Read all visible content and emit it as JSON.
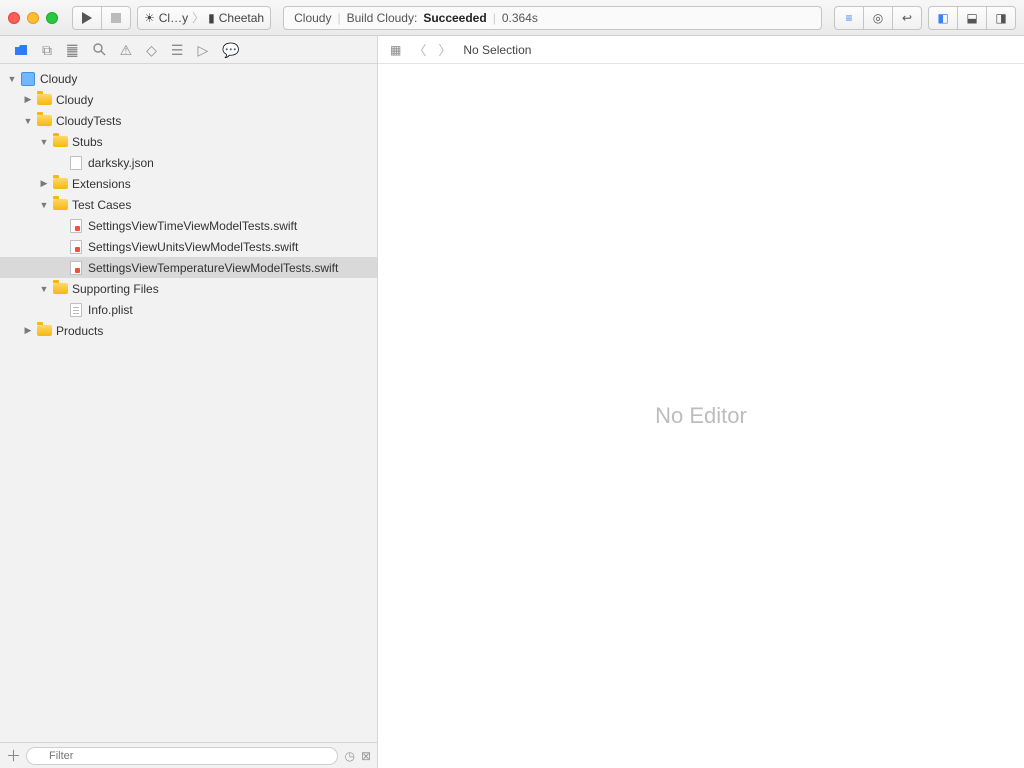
{
  "toolbar": {
    "scheme_app": "Cl…y",
    "scheme_device": "Cheetah",
    "activity_project": "Cloudy",
    "activity_prefix": "Build Cloudy:",
    "activity_status": "Succeeded",
    "activity_time": "0.364s"
  },
  "jumpbar": {
    "no_selection": "No Selection"
  },
  "editor": {
    "placeholder": "No Editor"
  },
  "filter": {
    "placeholder": "Filter"
  },
  "tree": [
    {
      "level": 0,
      "kind": "project",
      "expanded": true,
      "label": "Cloudy"
    },
    {
      "level": 1,
      "kind": "folder",
      "expanded": false,
      "label": "Cloudy"
    },
    {
      "level": 1,
      "kind": "folder",
      "expanded": true,
      "label": "CloudyTests"
    },
    {
      "level": 2,
      "kind": "folder",
      "expanded": true,
      "label": "Stubs"
    },
    {
      "level": 3,
      "kind": "file",
      "filetype": "json",
      "label": "darksky.json"
    },
    {
      "level": 2,
      "kind": "folder",
      "expanded": false,
      "label": "Extensions"
    },
    {
      "level": 2,
      "kind": "folder",
      "expanded": true,
      "label": "Test Cases"
    },
    {
      "level": 3,
      "kind": "file",
      "filetype": "swift",
      "label": "SettingsViewTimeViewModelTests.swift"
    },
    {
      "level": 3,
      "kind": "file",
      "filetype": "swift",
      "label": "SettingsViewUnitsViewModelTests.swift"
    },
    {
      "level": 3,
      "kind": "file",
      "filetype": "swift",
      "label": "SettingsViewTemperatureViewModelTests.swift",
      "selected": true
    },
    {
      "level": 2,
      "kind": "folder",
      "expanded": true,
      "label": "Supporting Files"
    },
    {
      "level": 3,
      "kind": "file",
      "filetype": "plist",
      "label": "Info.plist"
    },
    {
      "level": 1,
      "kind": "folder",
      "expanded": false,
      "label": "Products"
    }
  ]
}
